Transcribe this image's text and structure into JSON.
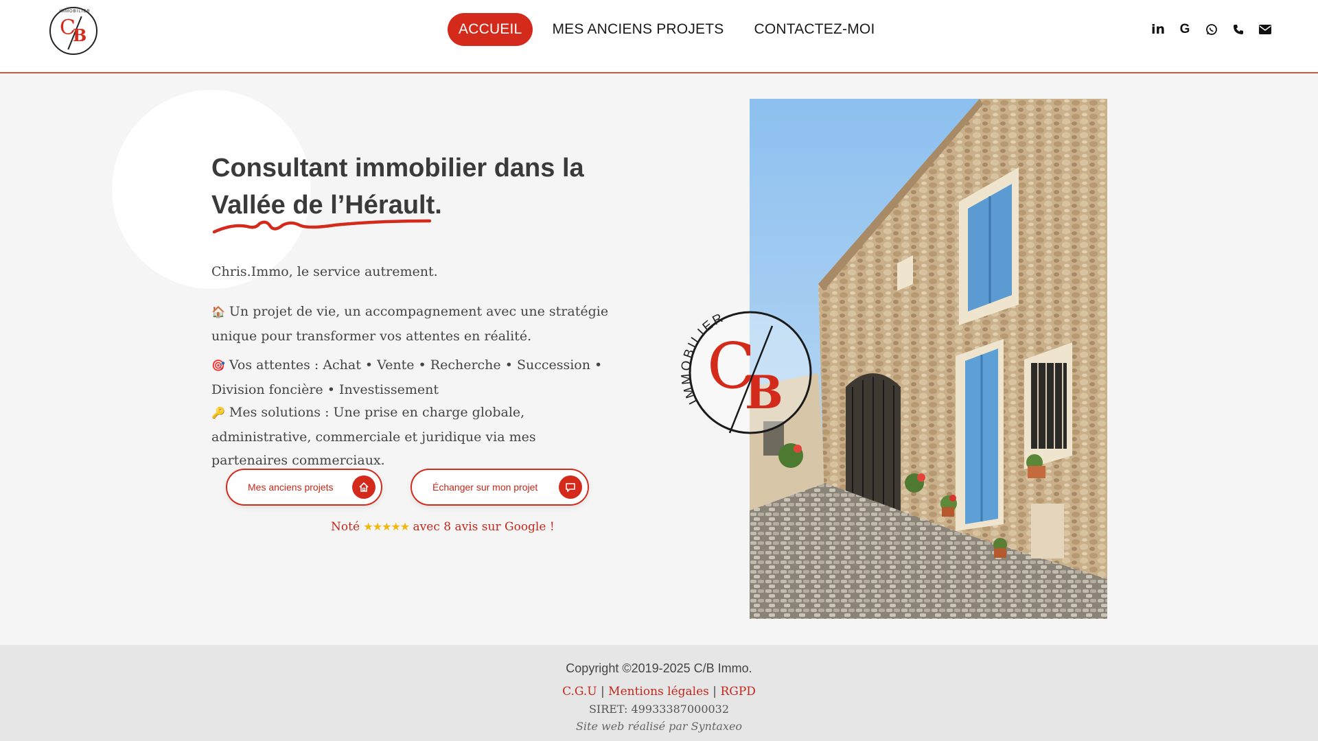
{
  "brand": {
    "logo_initials_c": "C",
    "logo_initials_b": "B",
    "logo_ring_text": "IMMOBILIER",
    "accent_color": "#d42a1c"
  },
  "nav": {
    "items": [
      {
        "label": "ACCUEIL",
        "active": true
      },
      {
        "label": "MES ANCIENS PROJETS",
        "active": false
      },
      {
        "label": "CONTACTEZ-MOI",
        "active": false
      }
    ]
  },
  "social": [
    {
      "icon": "linkedin-icon",
      "glyph": "in"
    },
    {
      "icon": "google-icon",
      "glyph": "G"
    },
    {
      "icon": "whatsapp-icon",
      "glyph": "✆"
    },
    {
      "icon": "phone-icon",
      "glyph": "☎"
    },
    {
      "icon": "mail-icon",
      "glyph": "✉"
    }
  ],
  "hero": {
    "title_line1": "Consultant immobilier dans la",
    "title_highlight": "Vallée de l’Hérault",
    "title_end": ".",
    "tagline": "Chris.Immo, le service autrement.",
    "p1_icon": "🏠",
    "p1_text": "Un projet de vie, un accompagnement avec une stratégie unique pour transformer vos attentes en réalité.",
    "p2_icon": "🎯",
    "p2_text": "Vos attentes : Achat • Vente • Recherche • Succession • Division foncière • Investissement",
    "p3_icon": "🔑",
    "p3_text": "Mes solutions : Une prise en charge globale, administrative, commerciale et juridique via mes partenaires commerciaux."
  },
  "buttons": {
    "projects_label": "Mes anciens projets",
    "projects_icon": "house-icon",
    "contact_label": "Échanger sur mon projet",
    "contact_icon": "chat-icon"
  },
  "rating": {
    "prefix": "Noté",
    "stars": "★★★★★",
    "stars_value": 5,
    "suffix": "avec 8 avis sur Google !"
  },
  "stamp": {
    "ring_text": "IMMOBILIER",
    "initial_c": "C",
    "initial_b": "B"
  },
  "footer": {
    "copyright": "Copyright ©2019-2025 C/B Immo.",
    "cgu": "C.G.U",
    "sep": "|",
    "mentions": "Mentions légales",
    "rgpd": "RGPD",
    "siret": "SIRET: 49933387000032",
    "credit": "Site web réalisé par Syntaxeo"
  }
}
